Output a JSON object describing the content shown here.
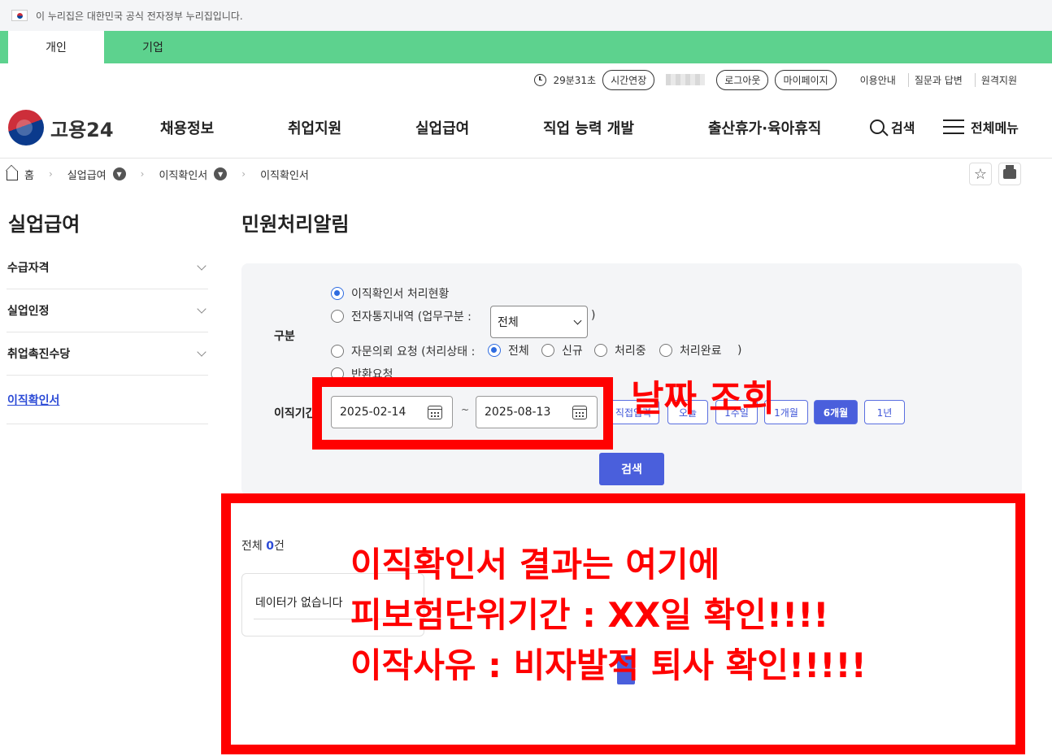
{
  "gov_banner": {
    "text": "이 누리집은 대한민국 공식 전자정부 누리집입니다."
  },
  "user_tabs": [
    {
      "label": "개인",
      "active": true
    },
    {
      "label": "기업",
      "active": false
    }
  ],
  "utility": {
    "session_time": "29분31초",
    "extend_label": "시간연장",
    "logout_label": "로그아웃",
    "mypage_label": "마이페이지",
    "links": [
      "이용안내",
      "질문과 답변",
      "원격지원"
    ]
  },
  "logo_text": "고용24",
  "gnb": [
    "채용정보",
    "취업지원",
    "실업급여",
    "직업 능력 개발",
    "출산휴가·육아휴직"
  ],
  "header": {
    "search_label": "검색",
    "menu_label": "전체메뉴"
  },
  "breadcrumb": [
    "홈",
    "실업급여",
    "이직확인서",
    "이직확인서"
  ],
  "lnb": {
    "title": "실업급여",
    "items": [
      {
        "label": "수급자격",
        "expandable": true
      },
      {
        "label": "실업인정",
        "expandable": true
      },
      {
        "label": "취업촉진수당",
        "expandable": true
      },
      {
        "label": "이직확인서",
        "expandable": false,
        "active": true
      }
    ]
  },
  "page_title": "민원처리알림",
  "form": {
    "category_label": "구분",
    "options": {
      "confirmation": "이직확인서 처리현황",
      "electronic_notice": "전자통지내역 (업무구분 :",
      "paren_close": ")",
      "consult": "자문의뢰 요청 (처리상태 :",
      "return_request": "반환요청"
    },
    "selected_option": "이직확인서 처리현황",
    "work_type_select": "전체",
    "status_options": [
      "전체",
      "신규",
      "처리중",
      "처리완료"
    ],
    "status_selected": "전체",
    "period_label": "이직기간",
    "date_from": "2025-02-14",
    "date_to": "2025-08-13",
    "date_separator": "~",
    "period_buttons": [
      "직접입력",
      "오늘",
      "1주일",
      "1개월",
      "6개월",
      "1년"
    ],
    "period_selected": "6개월",
    "search_button": "검색"
  },
  "results": {
    "total_prefix": "전체 ",
    "total_count": "0",
    "total_suffix": "건",
    "empty_message": "데이터가 없습니다"
  },
  "annotations": {
    "date_query": "날짜 조회",
    "result_lines": [
      "이직확인서 결과는 여기에",
      "피보험단위기간 : XX일 확인!!!!",
      "이작사유 : 비자발적 퇴사 확인!!!!!"
    ],
    "color": "#ff0000"
  },
  "colors": {
    "tab_bar": "#5dd28e",
    "primary": "#4a5fdc",
    "annotation": "#ff0000"
  }
}
